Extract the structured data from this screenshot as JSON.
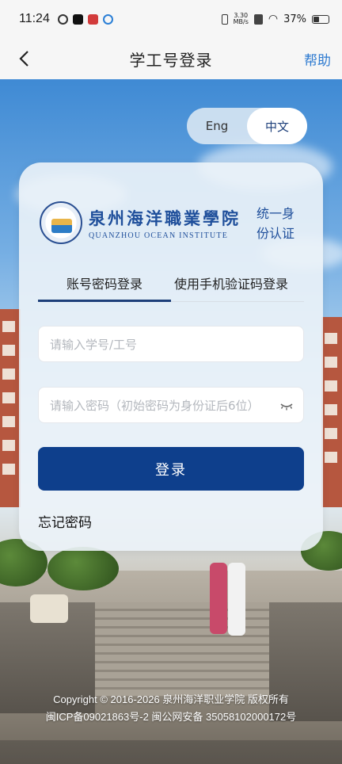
{
  "status_bar": {
    "time": "11:24",
    "speed_top": "3.30",
    "speed_bottom": "MB/s",
    "battery_percent": "37%",
    "icon_names": [
      "status-app-icon-1",
      "tiktok-icon",
      "status-app-icon-2",
      "status-app-icon-3"
    ]
  },
  "header": {
    "title": "学工号登录",
    "help_label": "帮助"
  },
  "language": {
    "options": [
      "Eng",
      "中文"
    ],
    "selected": "中文"
  },
  "brand": {
    "school_cn": "泉州海洋職業學院",
    "school_en": "QUANZHOU OCEAN INSTITUTE",
    "auth_line1": "统一身",
    "auth_line2": "份认证",
    "primary_color": "#0e3f8c"
  },
  "tabs": [
    {
      "label": "账号密码登录",
      "active": true
    },
    {
      "label": "使用手机验证码登录",
      "active": false
    }
  ],
  "form": {
    "username_placeholder": "请输入学号/工号",
    "password_placeholder": "请输入密码（初始密码为身份证后6位）",
    "login_label": "登录",
    "forgot_label": "忘记密码"
  },
  "footer": {
    "line1": "Copyright © 2016-2026 泉州海洋职业学院 版权所有",
    "line2": "闽ICP备09021863号-2 闽公网安备 35058102000172号"
  }
}
